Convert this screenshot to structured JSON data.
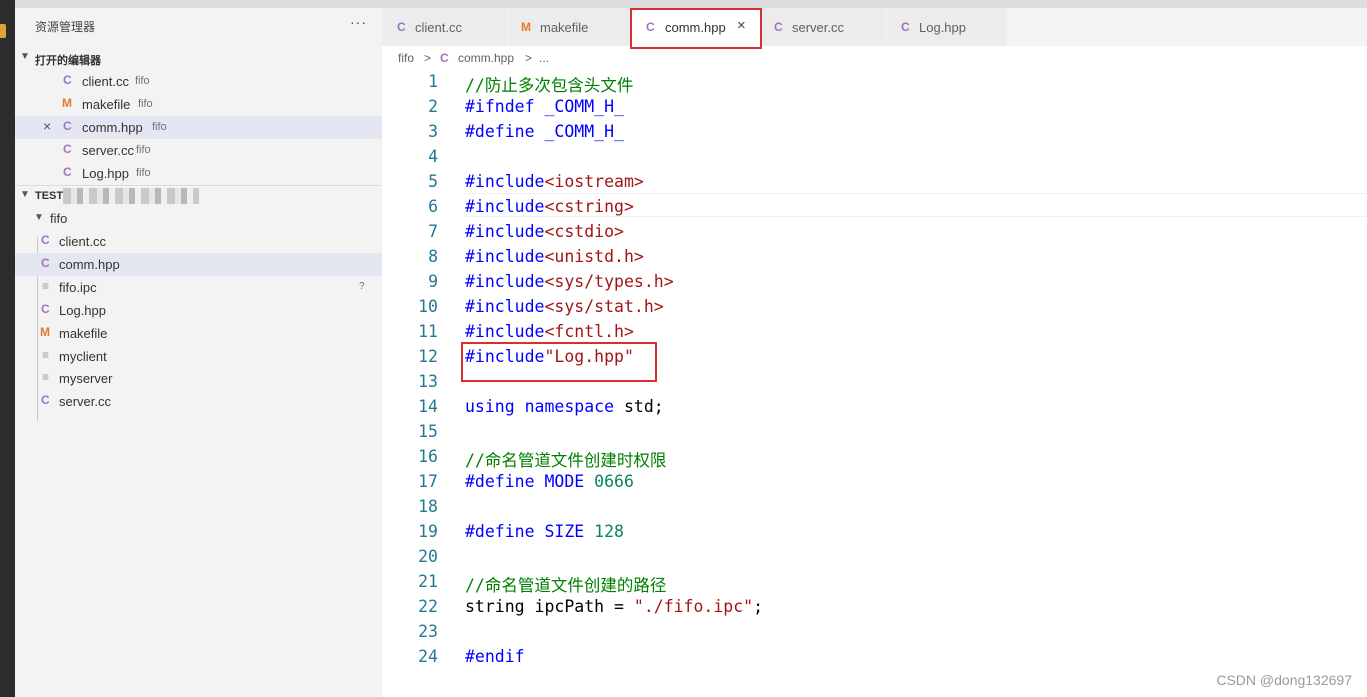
{
  "sidebar": {
    "title": "资源管理器",
    "more": "···",
    "open_editors_label": "打开的编辑器",
    "open_editors": [
      {
        "icon": "C",
        "name": "client.cc",
        "desc": "fifo"
      },
      {
        "icon": "M",
        "name": "makefile",
        "desc": "fifo"
      },
      {
        "icon": "C",
        "name": "comm.hpp",
        "desc": "fifo"
      },
      {
        "icon": "C",
        "name": "server.cc",
        "desc": "fifo"
      },
      {
        "icon": "C",
        "name": "Log.hpp",
        "desc": "fifo"
      }
    ],
    "close_icon": "×",
    "workspace_label": "TEST",
    "folder": "fifo",
    "files": [
      {
        "icon": "C",
        "name": "client.cc"
      },
      {
        "icon": "C",
        "name": "comm.hpp"
      },
      {
        "icon": "≡",
        "name": "fifo.ipc",
        "badge": "?"
      },
      {
        "icon": "C",
        "name": "Log.hpp"
      },
      {
        "icon": "M",
        "name": "makefile"
      },
      {
        "icon": "≡",
        "name": "myclient"
      },
      {
        "icon": "≡",
        "name": "myserver"
      },
      {
        "icon": "C",
        "name": "server.cc"
      }
    ]
  },
  "tabs": [
    {
      "icon": "C",
      "label": "client.cc"
    },
    {
      "icon": "M",
      "label": "makefile"
    },
    {
      "icon": "C",
      "label": "comm.hpp",
      "close": "×"
    },
    {
      "icon": "C",
      "label": "server.cc"
    },
    {
      "icon": "C",
      "label": "Log.hpp"
    }
  ],
  "breadcrumb": {
    "folder": "fifo",
    "sep": ">",
    "file": "comm.hpp",
    "more": "..."
  },
  "code": {
    "line_numbers": [
      "1",
      "2",
      "3",
      "4",
      "5",
      "6",
      "7",
      "8",
      "9",
      "10",
      "11",
      "12",
      "13",
      "14",
      "15",
      "16",
      "17",
      "18",
      "19",
      "20",
      "21",
      "22",
      "23",
      "24"
    ],
    "l1_com": "//防止多次包含头文件",
    "l2_pre": "#ifndef",
    "l2_rest": " _COMM_H_",
    "l3_pre": "#define",
    "l3_rest": " _COMM_H_",
    "inc": "#include",
    "l5_arg": "<iostream>",
    "l6_arg": "<cstring>",
    "l7_arg": "<cstdio>",
    "l8_arg": "<unistd.h>",
    "l9_arg": "<sys/types.h>",
    "l10_arg": "<sys/stat.h>",
    "l11_arg": "<fcntl.h>",
    "l12_arg": "\"Log.hpp\"",
    "l14_using": "using",
    "l14_ns": "namespace",
    "l14_rest": " std;",
    "l16_com": "//命名管道文件创建时权限",
    "l17_pre": "#define",
    "l17_name": " MODE ",
    "l17_num": "0666",
    "l19_pre": "#define",
    "l19_name": " SIZE ",
    "l19_num": "128",
    "l21_com": "//命名管道文件创建的路径",
    "l22_type": "string",
    "l22_rest": " ipcPath = ",
    "l22_str": "\"./fifo.ipc\"",
    "l22_end": ";",
    "l24_pre": "#endif"
  },
  "watermark": "CSDN @dong132697",
  "colors": {
    "highlight_box": "#d92f2f",
    "keyword": "#0000ff",
    "include_arg": "#a31515",
    "comment": "#008000",
    "number": "#098658",
    "line_number": "#237893"
  }
}
